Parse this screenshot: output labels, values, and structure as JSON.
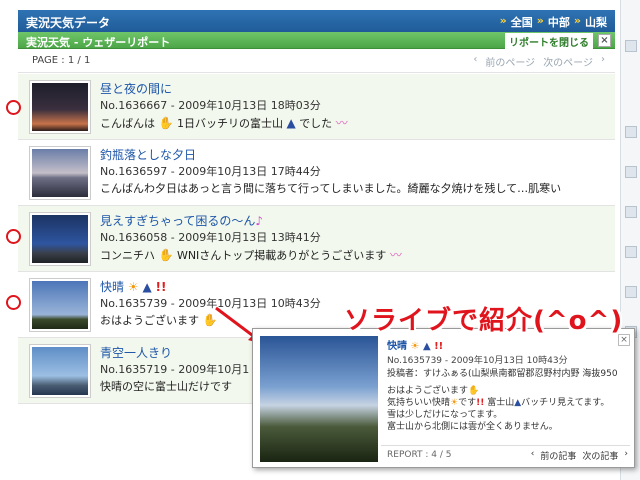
{
  "header": {
    "title": "実況天気データ",
    "breadcrumb": [
      "全国",
      "中部",
      "山梨"
    ],
    "separator": "»"
  },
  "subbar": {
    "title": "実況天気 - ウェザーリポート",
    "close_label": "リポートを閉じる",
    "close_icon": "×"
  },
  "pager": {
    "page": "PAGE : 1 / 1",
    "prev": "前のページ",
    "next": "次のページ",
    "prev_arrow": "‹",
    "next_arrow": "›"
  },
  "reports": [
    {
      "title": "昼と夜の間に",
      "meta": "No.1636667 - 2009年10月13日 18時03分",
      "body_parts": [
        "こんばんは",
        "1日バッチリの富士山",
        "でした"
      ],
      "icons": [
        "hand-icon",
        "mountain-icon",
        "lips-icon"
      ]
    },
    {
      "title": "釣瓶落としな夕日",
      "meta": "No.1636597 - 2009年10月13日 17時44分",
      "body": "こんばんわ夕日はあっと言う間に落ちて行ってしまいました。綺麗な夕焼けを残して…肌寒い"
    },
    {
      "title": "見えすぎちゃって困るの～ん",
      "title_icon": "♪",
      "meta": "No.1636058 - 2009年10月13日 13時41分",
      "body": "コンニチハ",
      "body2": "WNIさんトップ掲載ありがとうございます"
    },
    {
      "title": "快晴",
      "meta": "No.1635739 - 2009年10月13日 10時43分",
      "body": "おはようございます"
    },
    {
      "title": "青空一人きり",
      "meta": "No.1635719 - 2009年10月1",
      "body": "快晴の空に富士山だけです"
    }
  ],
  "popup": {
    "title": "快晴",
    "meta": "No.1635739 - 2009年10月13日 10時43分",
    "author": "投稿者：すけふぁる(山梨県南都留郡忍野村内野 海抜950",
    "lines": [
      "おはようございます",
      "気持ちいい快晴",
      "です",
      "富士山",
      "バッチリ見えてます。",
      "雪は少しだけになってます。",
      "富士山から北側には雲が全くありません。"
    ],
    "report_count": "REPORT : 4 / 5",
    "prev": "前の記事",
    "next": "次の記事",
    "prev_arrow": "‹",
    "next_arrow": "›",
    "close_icon": "×"
  },
  "annotation": {
    "text": "ソライブで紹介(^o^)",
    "color": "#e0141c"
  },
  "icons": {
    "sun": "☀",
    "mountain": "▲",
    "bang": "!!",
    "hand": "✋",
    "lips": "〰",
    "note": "♪"
  }
}
